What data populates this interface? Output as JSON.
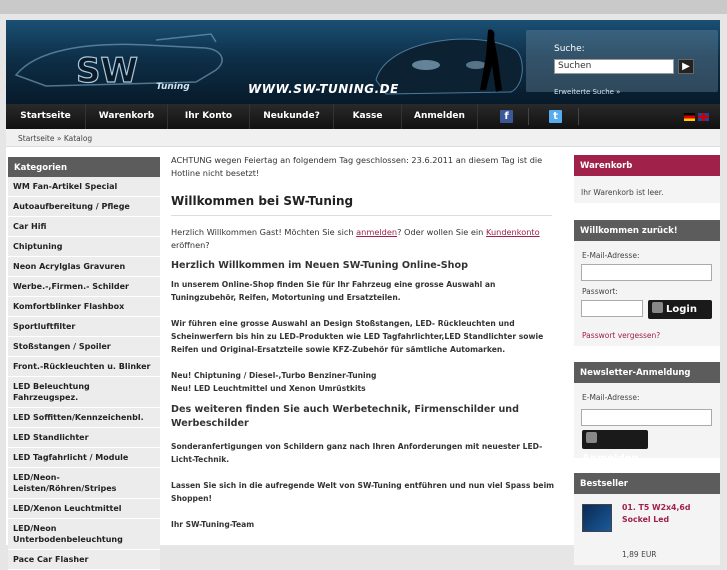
{
  "banner": {
    "site_url_text": "WWW.SW-TUNING.DE",
    "logo_text": "Tuning",
    "search": {
      "label": "Suche:",
      "value": "Suchen",
      "advanced_link": "Erweiterte Suche »"
    }
  },
  "nav": {
    "items": [
      {
        "label": "Startseite"
      },
      {
        "label": "Warenkorb"
      },
      {
        "label": "Ihr Konto"
      },
      {
        "label": "Neukunde?"
      },
      {
        "label": "Kasse"
      },
      {
        "label": "Anmelden"
      }
    ]
  },
  "breadcrumb": "Startseite » Katalog",
  "categories": {
    "title": "Kategorien",
    "items": [
      "WM Fan-Artikel Special",
      "Autoaufbereitung / Pflege",
      "Car Hifi",
      "Chiptuning",
      "Neon Acrylglas Gravuren",
      "Werbe.-,Firmen.- Schilder",
      "Komfortblinker Flashbox",
      "Sportluftfilter",
      "Stoßstangen / Spoiler",
      "Front.-Rückleuchten u. Blinker",
      "LED Beleuchtung Fahrzeugspez.",
      "LED Soffitten/Kennzeichenbl.",
      "LED Standlichter",
      "LED Tagfahrlicht / Module",
      "LED/Neon-Leisten/Röhren/Stripes",
      "LED/Xenon Leuchtmittel",
      "LED/Neon Unterbodenbeleuchtung",
      "Pace Car Flasher"
    ]
  },
  "main": {
    "notice": "ACHTUNG wegen Feiertag an folgendem Tag geschlossen: 23.6.2011 an diesem Tag ist die Hotline nicht besetzt!",
    "welcome_title": "Willkommen bei SW-Tuning",
    "greet_pre": "Herzlich Willkommen Gast! Möchten Sie sich ",
    "greet_link1": "anmelden",
    "greet_mid": "? Oder wollen Sie ein ",
    "greet_link2": "Kundenkonto",
    "greet_post": " eröffnen?",
    "shop_title": "Herzlich Willkommen im Neuen SW-Tuning Online-Shop",
    "para1": "In unserem Online-Shop finden Sie für Ihr Fahrzeug eine grosse Auswahl an Tuningzubehör, Reifen, Motortuning und Ersatzteilen.",
    "para2": "Wir führen eine grosse Auswahl an Design Stoßstangen, LED- Rückleuchten und Scheinwerfern bis hin zu LED-Produkten wie LED Tagfahrlichter,LED Standlichter sowie Reifen und Original-Ersatzteile sowie KFZ-Zubehör für sämtliche Automarken.",
    "para3a": "Neu! Chiptuning / Diesel-,Turbo Benziner-Tuning",
    "para3b": "Neu! LED Leuchtmittel und Xenon Umrüstkits",
    "werbe_title": "Des weiteren finden Sie auch Werbetechnik, Firmenschilder und Werbeschilder",
    "para4": "Sonderanfertigungen von Schildern ganz nach Ihren Anforderungen mit neuester LED-Licht-Technik.",
    "para5": "Lassen Sie sich in die aufregende Welt von SW-Tuning entführen und nun viel Spass beim Shoppen!",
    "signature": "Ihr SW-Tuning-Team"
  },
  "cart": {
    "title": "Warenkorb",
    "text": "Ihr Warenkorb ist leer."
  },
  "login": {
    "title": "Willkommen zurück!",
    "email_label": "E-Mail-Adresse:",
    "password_label": "Passwort:",
    "button": "Login",
    "forgot": "Passwort vergessen?"
  },
  "newsletter": {
    "title": "Newsletter-Anmeldung",
    "email_label": "E-Mail-Adresse:",
    "button": "Anmelden"
  },
  "bestseller": {
    "title": "Bestseller",
    "item_title": "01. T5 W2x4,6d Sockel Led",
    "item_price": "1,89 EUR"
  },
  "colors": {
    "accent": "#a0214a",
    "nav_bg": "#111111",
    "box_head": "#5c5c5c"
  }
}
